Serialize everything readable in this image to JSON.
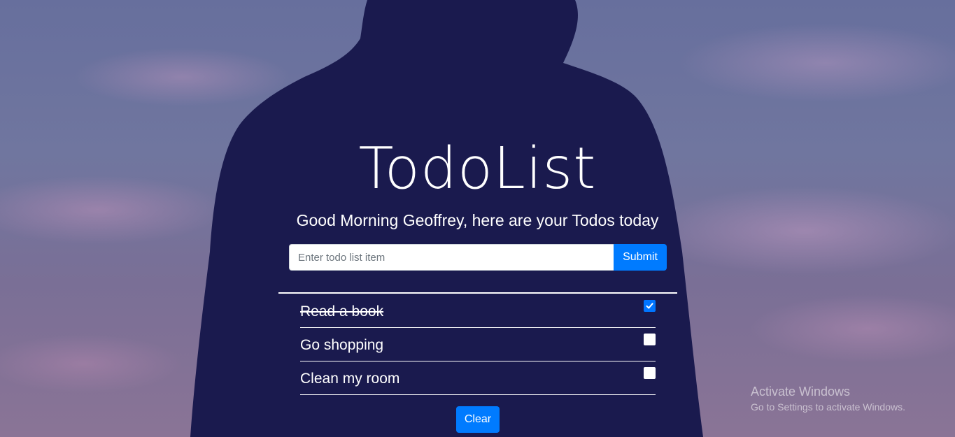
{
  "app": {
    "title": "TodoList",
    "greeting": "Good Morning Geoffrey, here are your Todos today"
  },
  "form": {
    "placeholder": "Enter todo list item",
    "value": "",
    "submit_label": "Submit"
  },
  "todos": [
    {
      "text": "Read a book",
      "completed": true
    },
    {
      "text": "Go shopping",
      "completed": false
    },
    {
      "text": "Clean my room",
      "completed": false
    }
  ],
  "actions": {
    "clear_label": "Clear"
  },
  "watermark": {
    "title": "Activate Windows",
    "subtitle": "Go to Settings to activate Windows."
  },
  "colors": {
    "primary": "#007bff",
    "silhouette": "#1a1a4e",
    "text": "#ffffff"
  }
}
